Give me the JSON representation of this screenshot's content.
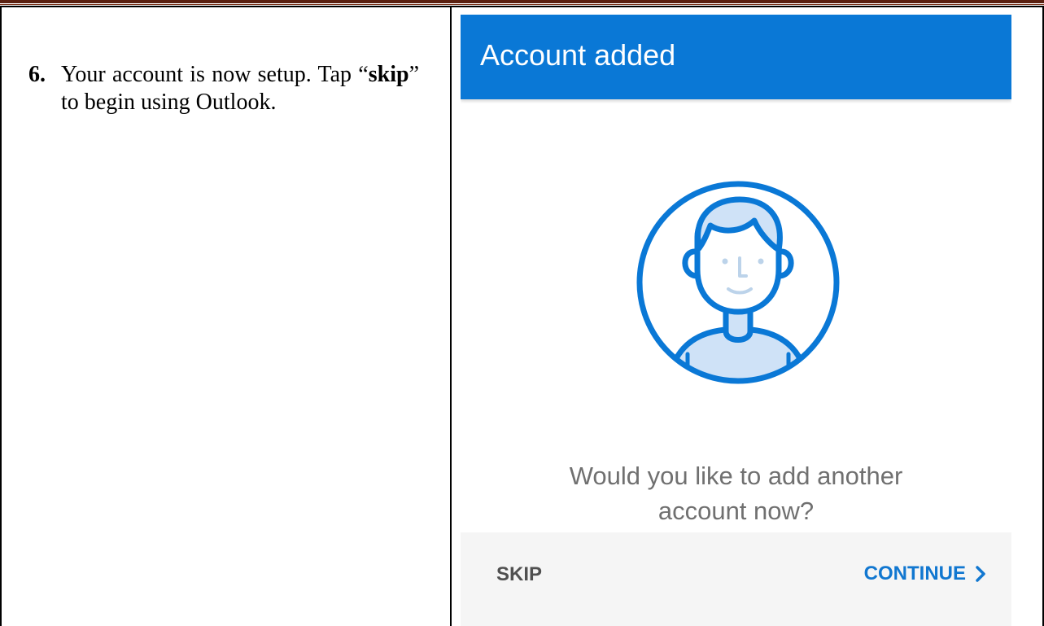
{
  "document": {
    "step": {
      "number": "6.",
      "text_before": "Your account is now setup. Tap “",
      "text_emphasis": "skip",
      "text_after": "” to begin using Outlook."
    }
  },
  "app": {
    "header_title": "Account added",
    "avatar_icon": "person-avatar-icon",
    "prompt_line1": "Would you like to add another",
    "prompt_line2": "account now?",
    "skip_label": "SKIP",
    "continue_label": "CONTINUE",
    "continue_icon": "chevron-right-icon"
  },
  "colors": {
    "header_blue": "#0a78d6",
    "accent_blue": "#1177d0",
    "avatar_fill": "#cfe2f7",
    "prompt_gray": "#707070",
    "footer_bg": "#f5f5f5",
    "rule_brown": "#5a2010"
  }
}
